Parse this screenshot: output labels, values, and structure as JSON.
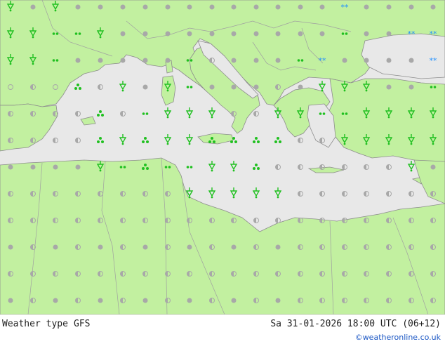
{
  "map": {
    "colors": {
      "land": "#c2f0a0",
      "sea": "#e8e8e8",
      "border": "#a0a0a0",
      "coast": "#8c8c8c",
      "rain": "#20c020",
      "snow": "#2090ff",
      "dry": "#a8a8a8"
    },
    "legend_icons": [
      "rain-shower-icon",
      "heavy-rain-icon",
      "drizzle-icon",
      "thunderstorm-icon",
      "snow-icon",
      "cloudy-icon",
      "partly-cloudy-icon",
      "clear-icon"
    ]
  },
  "footer": {
    "product": "Weather type",
    "model": "GFS",
    "valid": "Sa 31-01-2026 18:00 UTC (06+12)",
    "credit": "©weatheronline.co.uk"
  }
}
